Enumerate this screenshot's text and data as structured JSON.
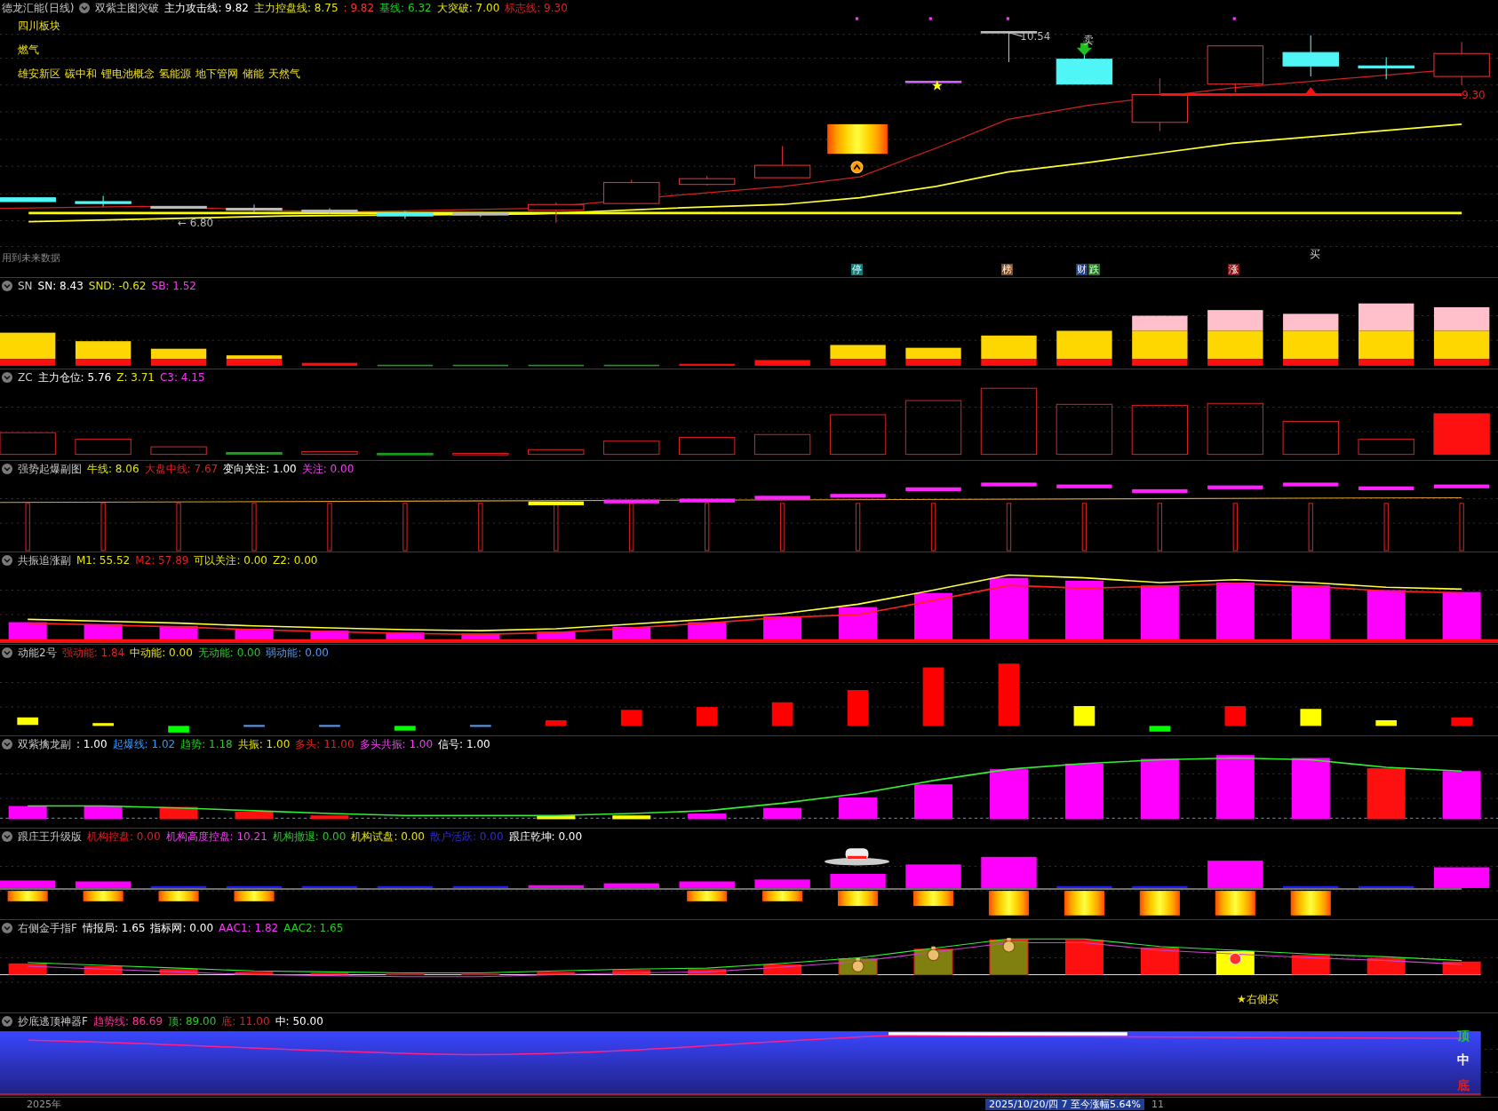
{
  "main": {
    "title": "德龙汇能(日线)",
    "indicator": "双紫主图突破",
    "values": [
      {
        "text": "主力攻击线: 9.82",
        "color": "#ffffff"
      },
      {
        "text": "主力控盘线: 8.75",
        "color": "#e6e600"
      },
      {
        "text": ": 9.82",
        "color": "#ff3030"
      },
      {
        "text": "基线: 6.32",
        "color": "#22cc22"
      },
      {
        "text": "大突破: 7.00",
        "color": "#e6e600"
      },
      {
        "text": "标志线: 9.30",
        "color": "#e02020"
      }
    ],
    "sector_lines": [
      [
        "四川板块"
      ],
      [
        "燃气"
      ],
      [
        "雄安新区",
        "碳中和",
        "锂电池概念",
        "氢能源",
        "地下管网",
        "储能",
        "天然气"
      ]
    ],
    "high_label": "10.54",
    "low_label": "← 6.80",
    "line_label": "9.30",
    "sell_label": "卖",
    "buy_label": "买",
    "notice": "用到未来数据",
    "event_tags": [
      {
        "text": "停",
        "color": "#0e7c7b"
      },
      {
        "text": "榜",
        "color": "#8a4a18"
      },
      {
        "text": "财",
        "color": "#1c3c8c"
      },
      {
        "text": "跌",
        "color": "#1c7c1c"
      },
      {
        "text": "涨",
        "color": "#8c1010"
      }
    ]
  },
  "panels": [
    {
      "kind": "sn",
      "name": "SN",
      "values": [
        {
          "text": "SN: 8.43",
          "color": "#ffffff"
        },
        {
          "text": "SND: -0.62",
          "color": "#e6e600"
        },
        {
          "text": "SB: 1.52",
          "color": "#ff33ff"
        }
      ]
    },
    {
      "kind": "zc",
      "name": "ZC",
      "values": [
        {
          "text": "主力仓位: 5.76",
          "color": "#ffffff"
        },
        {
          "text": "Z: 3.71",
          "color": "#e6e600"
        },
        {
          "text": "C3: 4.15",
          "color": "#ff33ff"
        }
      ]
    },
    {
      "kind": "qs",
      "name": "强势起爆副图",
      "values": [
        {
          "text": "牛线: 8.06",
          "color": "#e6e600"
        },
        {
          "text": "大盘中线: 7.67",
          "color": "#e02020"
        },
        {
          "text": "变向关注: 1.00",
          "color": "#ffffff"
        },
        {
          "text": "关注: 0.00",
          "color": "#ff33ff"
        }
      ]
    },
    {
      "kind": "gz",
      "name": "共振追涨副",
      "values": [
        {
          "text": "M1: 55.52",
          "color": "#e6e600"
        },
        {
          "text": "M2: 57.89",
          "color": "#e02020"
        },
        {
          "text": "可以关注: 0.00",
          "color": "#e6e600"
        },
        {
          "text": "Z2: 0.00",
          "color": "#e6e600"
        }
      ]
    },
    {
      "kind": "dn",
      "name": "动能2号",
      "values": [
        {
          "text": "强动能: 1.84",
          "color": "#e02020"
        },
        {
          "text": "中动能: 0.00",
          "color": "#e6e600"
        },
        {
          "text": "无动能: 0.00",
          "color": "#22cc22"
        },
        {
          "text": "弱动能: 0.00",
          "color": "#5599ee"
        }
      ]
    },
    {
      "kind": "sz",
      "name": "双紫擒龙副",
      "values": [
        {
          "text": ": 1.00",
          "color": "#ffffff"
        },
        {
          "text": "起爆线: 1.02",
          "color": "#3399ff"
        },
        {
          "text": "趋势: 1.18",
          "color": "#22cc22"
        },
        {
          "text": "共振: 1.00",
          "color": "#e6e600"
        },
        {
          "text": "多头: 11.00",
          "color": "#e02020"
        },
        {
          "text": "多头共振: 1.00",
          "color": "#ff33ff"
        },
        {
          "text": "信号: 1.00",
          "color": "#ffffff"
        }
      ]
    },
    {
      "kind": "gzw",
      "name": "跟庄王升级版",
      "values": [
        {
          "text": "机构控盘: 0.00",
          "color": "#e02020"
        },
        {
          "text": "机构高度控盘: 10.21",
          "color": "#ff33ff"
        },
        {
          "text": "机构撤退: 0.00",
          "color": "#22cc22"
        },
        {
          "text": "机构试盘: 0.00",
          "color": "#e6e600"
        },
        {
          "text": "散户活跃: 0.00",
          "color": "#2a2ae0"
        },
        {
          "text": "跟庄乾坤: 0.00",
          "color": "#ffffff"
        }
      ]
    },
    {
      "kind": "yc",
      "name": "右侧金手指F",
      "note": "★右侧买",
      "values": [
        {
          "text": "情报局: 1.65",
          "color": "#ffffff"
        },
        {
          "text": "指标网: 0.00",
          "color": "#ffffff"
        },
        {
          "text": "AAC1: 1.82",
          "color": "#ff33ff"
        },
        {
          "text": "AAC2: 1.65",
          "color": "#22cc22"
        }
      ]
    },
    {
      "kind": "cd",
      "name": "抄底逃顶神器F",
      "values": [
        {
          "text": "趋势线: 86.69",
          "color": "#ff3399"
        },
        {
          "text": "顶: 89.00",
          "color": "#22cc22"
        },
        {
          "text": "底: 11.00",
          "color": "#e02020"
        },
        {
          "text": "中: 50.00",
          "color": "#ffffff"
        }
      ],
      "levels": [
        {
          "text": "顶",
          "color": "#22cc22"
        },
        {
          "text": "中",
          "color": "#ffffff"
        },
        {
          "text": "底",
          "color": "#e02020"
        }
      ]
    }
  ],
  "axis": {
    "year": "2025年",
    "cursor": "2025/10/20/四 7 至今涨幅5.64%",
    "tick": "11"
  }
}
